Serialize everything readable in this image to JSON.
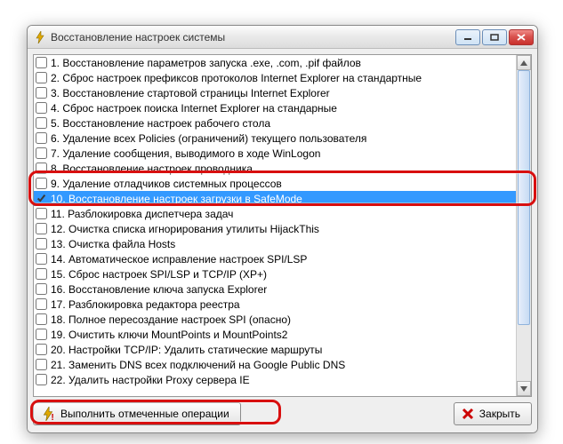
{
  "window": {
    "title": "Восстановление настроек системы",
    "icon": "lightning-icon"
  },
  "controls": {
    "minimize": "minimize-icon",
    "maximize": "maximize-icon",
    "close": "close-icon"
  },
  "list": {
    "scroll_offset": 0,
    "items": [
      {
        "n": "1",
        "label": "1. Восстановление параметров запуска .exe, .com, .pif файлов",
        "checked": false,
        "selected": false
      },
      {
        "n": "2",
        "label": "2. Сброс настроек префиксов протоколов Internet Explorer на стандартные",
        "checked": false,
        "selected": false
      },
      {
        "n": "3",
        "label": "3. Восстановление стартовой страницы Internet Explorer",
        "checked": false,
        "selected": false
      },
      {
        "n": "4",
        "label": "4. Сброс настроек поиска Internet Explorer на стандарные",
        "checked": false,
        "selected": false
      },
      {
        "n": "5",
        "label": "5. Восстановление настроек рабочего стола",
        "checked": false,
        "selected": false
      },
      {
        "n": "6",
        "label": "6. Удаление всех Policies (ограничений) текущего пользователя",
        "checked": false,
        "selected": false
      },
      {
        "n": "7",
        "label": "7. Удаление сообщения, выводимого в ходе WinLogon",
        "checked": false,
        "selected": false
      },
      {
        "n": "8",
        "label": "8. Восстановление настроек проводника",
        "checked": false,
        "selected": false
      },
      {
        "n": "9",
        "label": "9. Удаление отладчиков системных процессов",
        "checked": false,
        "selected": false
      },
      {
        "n": "10",
        "label": "10. Восстановление настроек загрузки в SafeMode",
        "checked": true,
        "selected": true
      },
      {
        "n": "11",
        "label": "11. Разблокировка диспетчера задач",
        "checked": false,
        "selected": false
      },
      {
        "n": "12",
        "label": "12. Очистка списка игнорирования утилиты HijackThis",
        "checked": false,
        "selected": false
      },
      {
        "n": "13",
        "label": "13. Очистка файла Hosts",
        "checked": false,
        "selected": false
      },
      {
        "n": "14",
        "label": "14. Автоматическое исправление настроек SPI/LSP",
        "checked": false,
        "selected": false
      },
      {
        "n": "15",
        "label": "15. Сброс настроек SPI/LSP и TCP/IP (XP+)",
        "checked": false,
        "selected": false
      },
      {
        "n": "16",
        "label": "16. Восстановление ключа запуска Explorer",
        "checked": false,
        "selected": false
      },
      {
        "n": "17",
        "label": "17. Разблокировка редактора реестра",
        "checked": false,
        "selected": false
      },
      {
        "n": "18",
        "label": "18. Полное пересоздание настроек SPI (опасно)",
        "checked": false,
        "selected": false
      },
      {
        "n": "19",
        "label": "19. Очистить ключи MountPoints и MountPoints2",
        "checked": false,
        "selected": false
      },
      {
        "n": "20",
        "label": "20. Настройки TCP/IP: Удалить статические маршруты",
        "checked": false,
        "selected": false
      },
      {
        "n": "21",
        "label": "21. Заменить DNS всех подключений на Google Public DNS",
        "checked": false,
        "selected": false
      },
      {
        "n": "22",
        "label": "22. Удалить настройки Proxy сервера IE",
        "checked": false,
        "selected": false
      }
    ]
  },
  "buttons": {
    "execute": "Выполнить отмеченные операции",
    "close": "Закрыть"
  },
  "colors": {
    "highlight": "#d80f0f",
    "selection": "#3399ff"
  }
}
